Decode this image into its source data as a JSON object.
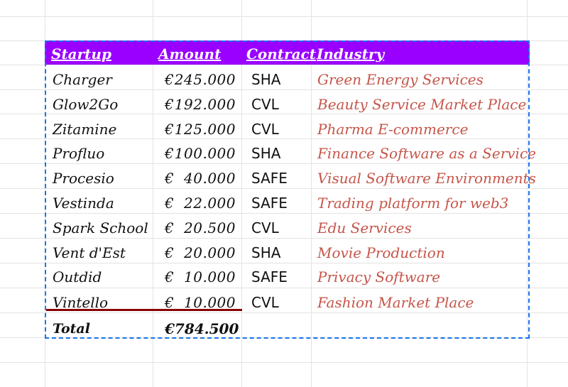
{
  "headers": {
    "startup": "Startup",
    "amount": "Amount",
    "contract": "Contract",
    "industry": "Industry"
  },
  "rows": [
    {
      "startup": "Charger",
      "currency": "€",
      "amount": "245.000",
      "contract": "SHA",
      "industry": "Green Energy Services"
    },
    {
      "startup": "Glow2Go",
      "currency": "€",
      "amount": "192.000",
      "contract": "CVL",
      "industry": "Beauty Service Market Place"
    },
    {
      "startup": "Zitamine",
      "currency": "€",
      "amount": "125.000",
      "contract": "CVL",
      "industry": "Pharma E-commerce"
    },
    {
      "startup": "Profluo",
      "currency": "€",
      "amount": "100.000",
      "contract": "SHA",
      "industry": "Finance Software as a Service"
    },
    {
      "startup": "Procesio",
      "currency": "€",
      "amount": "40.000",
      "contract": "SAFE",
      "industry": "Visual Software Environments"
    },
    {
      "startup": "Vestinda",
      "currency": "€",
      "amount": "22.000",
      "contract": "SAFE",
      "industry": "Trading platform for web3"
    },
    {
      "startup": "Spark School",
      "currency": "€",
      "amount": "20.500",
      "contract": "CVL",
      "industry": "Edu Services"
    },
    {
      "startup": "Vent d'Est",
      "currency": "€",
      "amount": "20.000",
      "contract": "SHA",
      "industry": "Movie Production"
    },
    {
      "startup": "Outdid",
      "currency": "€",
      "amount": "10.000",
      "contract": "SAFE",
      "industry": "Privacy Software"
    },
    {
      "startup": "Vintello",
      "currency": "€",
      "amount": "10.000",
      "contract": "CVL",
      "industry": "Fashion Market Place"
    }
  ],
  "total": {
    "label": "Total",
    "value": "€784.500"
  },
  "colors": {
    "header_bg": "#9900ff",
    "industry_text": "#c5554a",
    "selection_border": "#1a73e8",
    "underline": "#8b0000"
  }
}
